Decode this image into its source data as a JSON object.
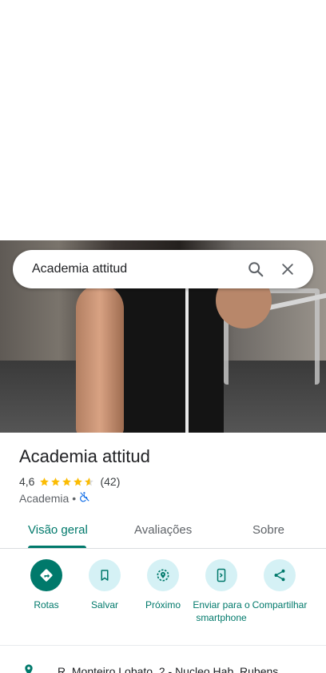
{
  "search": {
    "query": "Academia attitud"
  },
  "place": {
    "name": "Academia attitud",
    "rating": "4,6",
    "review_count": "(42)",
    "star_rating": 4.6,
    "category": "Academia",
    "separator": "•"
  },
  "tabs": [
    {
      "label": "Visão geral",
      "active": true
    },
    {
      "label": "Avaliações",
      "active": false
    },
    {
      "label": "Sobre",
      "active": false
    }
  ],
  "actions": [
    {
      "label": "Rotas",
      "icon": "directions-icon"
    },
    {
      "label": "Salvar",
      "icon": "bookmark-icon"
    },
    {
      "label": "Próximo",
      "icon": "nearby-icon"
    },
    {
      "label": "Enviar para o smartphone",
      "icon": "send-to-phone-icon"
    },
    {
      "label": "Compartilhar",
      "icon": "share-icon"
    }
  ],
  "address": {
    "text": "R. Monteiro Lobato, 2 - Nucleo Hab. Rubens"
  },
  "colors": {
    "accent": "#00796b",
    "action_bg": "#d5f1f5",
    "star": "#fbbc04"
  }
}
